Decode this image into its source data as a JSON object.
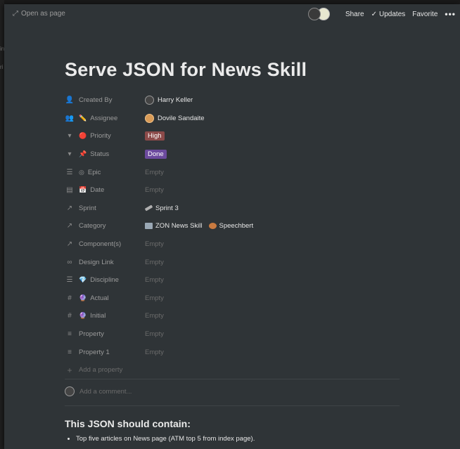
{
  "topbar": {
    "open_as_page": "Open as page",
    "share": "Share",
    "updates": "Updates",
    "favorite": "Favorite",
    "more": "•••"
  },
  "background": {
    "peek_letter": "(",
    "edge_text_1": "in",
    "edge_text_2": "ri"
  },
  "page": {
    "title": "Serve JSON for News Skill"
  },
  "properties": [
    {
      "name": "Created By",
      "icon": "person-icon",
      "glyph": "👤",
      "type": "person",
      "value": "Harry Keller"
    },
    {
      "name": "Assignee",
      "icon": "people-icon",
      "glyph": "👥",
      "emoji": "✏️",
      "type": "person",
      "value": "Dovile Sandaite"
    },
    {
      "name": "Priority",
      "icon": "select-icon",
      "glyph": "▾",
      "emoji": "🔴",
      "type": "tag",
      "value": "High",
      "color": "#8c4a49"
    },
    {
      "name": "Status",
      "icon": "select-icon",
      "glyph": "▾",
      "emoji": "📌",
      "type": "tag",
      "value": "Done",
      "color": "#6c4a9e"
    },
    {
      "name": "Epic",
      "icon": "list-icon",
      "glyph": "☰",
      "emoji": "◎",
      "type": "empty",
      "value": "Empty"
    },
    {
      "name": "Date",
      "icon": "calendar-icon",
      "glyph": "▤",
      "emoji": "📅",
      "type": "empty",
      "value": "Empty"
    },
    {
      "name": "Sprint",
      "icon": "relation-icon",
      "glyph": "↗",
      "type": "relation",
      "items": [
        "Sprint 3"
      ]
    },
    {
      "name": "Category",
      "icon": "relation-icon",
      "glyph": "↗",
      "type": "relation",
      "items": [
        "ZON News Skill",
        "Speechbert"
      ]
    },
    {
      "name": "Component(s)",
      "icon": "relation-icon",
      "glyph": "↗",
      "type": "empty",
      "value": "Empty"
    },
    {
      "name": "Design Link",
      "icon": "link-icon",
      "glyph": "∞",
      "type": "empty",
      "value": "Empty"
    },
    {
      "name": "Discipline",
      "icon": "list-icon",
      "glyph": "☰",
      "emoji": "💎",
      "type": "empty",
      "value": "Empty"
    },
    {
      "name": "Actual",
      "icon": "hash-icon",
      "glyph": "#",
      "emoji": "🔮",
      "type": "empty",
      "value": "Empty"
    },
    {
      "name": "Initial",
      "icon": "hash-icon",
      "glyph": "#",
      "emoji": "🔮",
      "type": "empty",
      "value": "Empty"
    },
    {
      "name": "Property",
      "icon": "text-icon",
      "glyph": "≡",
      "type": "empty",
      "value": "Empty"
    },
    {
      "name": "Property 1",
      "icon": "text-icon",
      "glyph": "≡",
      "type": "empty",
      "value": "Empty"
    }
  ],
  "add_property": "Add a property",
  "comment": {
    "placeholder": "Add a comment..."
  },
  "content": {
    "heading": "This JSON should contain:",
    "bullets": [
      "Top five articles on News page (ATM top 5 from index page)."
    ]
  },
  "colors": {
    "panel": "#2f3437",
    "tag_high": "#8c4a49",
    "tag_done": "#6c4a9e"
  }
}
